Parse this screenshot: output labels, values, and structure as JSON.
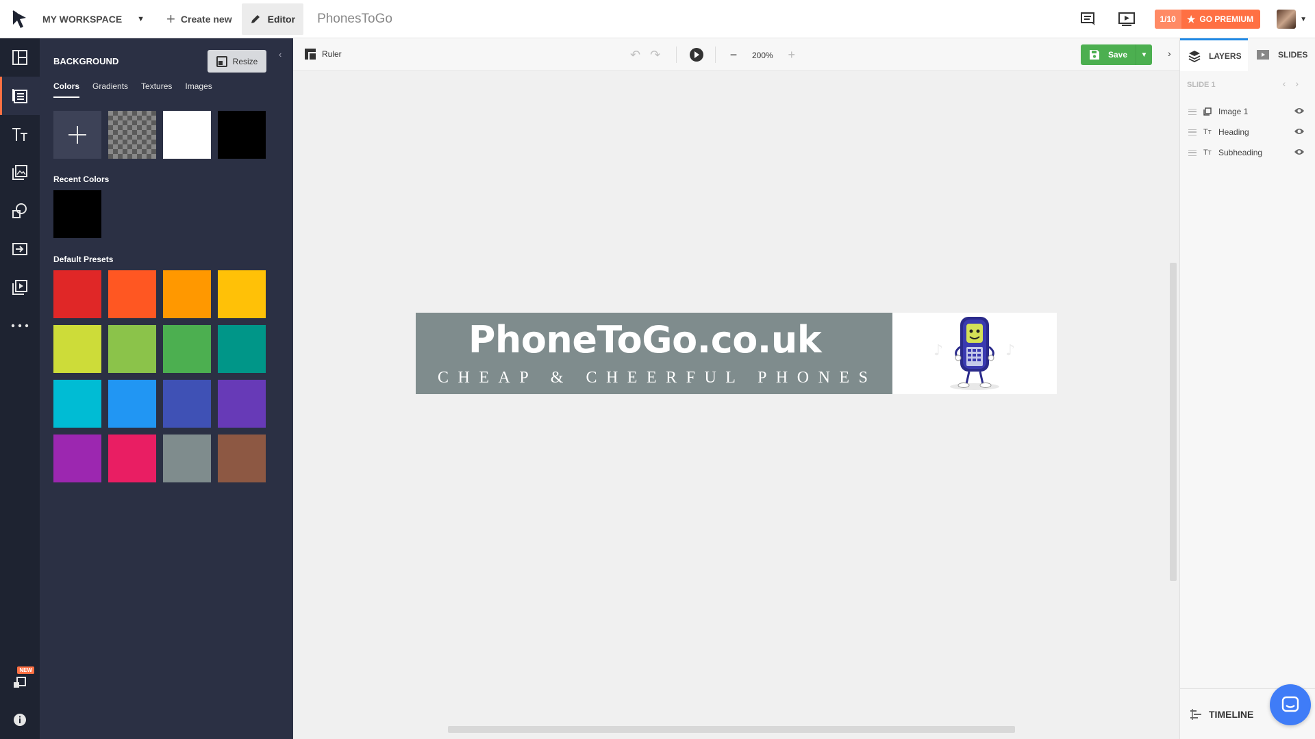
{
  "topbar": {
    "workspace_label": "MY WORKSPACE",
    "create_label": "Create new",
    "editor_label": "Editor",
    "document_title": "PhonesToGo",
    "premium_count": "1/10",
    "premium_label": "GO PREMIUM"
  },
  "rail": {
    "items": [
      "layout-icon",
      "background-icon",
      "text-icon",
      "images-icon",
      "shapes-icon",
      "import-icon",
      "animation-icon",
      "more-icon"
    ],
    "new_badge": "NEW"
  },
  "background_panel": {
    "title": "BACKGROUND",
    "resize_label": "Resize",
    "tabs": [
      "Colors",
      "Gradients",
      "Textures",
      "Images"
    ],
    "active_tab": "Colors",
    "recent_label": "Recent Colors",
    "defaults_label": "Default Presets",
    "top_swatches": [
      "add",
      "transparent",
      "#ffffff",
      "#000000"
    ],
    "recent_colors": [
      "#000000"
    ],
    "presets": [
      "#e02727",
      "#ff5722",
      "#ff9800",
      "#ffc107",
      "#cddc39",
      "#8bc34a",
      "#4caf50",
      "#009688",
      "#00bcd4",
      "#2196f3",
      "#3f51b5",
      "#673ab7",
      "#9c27b0",
      "#e91e63",
      "#7f8c8d",
      "#8d5843"
    ]
  },
  "canvas_toolbar": {
    "ruler_label": "Ruler",
    "zoom_value": "200%",
    "save_label": "Save"
  },
  "banner": {
    "heading": "PhoneToGo.co.uk",
    "subheading": "CHEAP & CHEERFUL PHONES",
    "bg_color": "#7f8c8d"
  },
  "right_panel": {
    "layers_tab": "LAYERS",
    "slides_tab": "SLIDES",
    "slide_label": "SLIDE 1",
    "layers": [
      {
        "name": "Image 1",
        "type": "image-icon"
      },
      {
        "name": "Heading",
        "type": "text-icon"
      },
      {
        "name": "Subheading",
        "type": "text-icon"
      }
    ],
    "timeline_label": "TIMELINE"
  },
  "colors": {
    "accent_orange": "#ff7043",
    "save_green": "#4caf50",
    "rail_bg": "#1e2331",
    "panel_bg": "#2b3044",
    "layers_blue": "#1e88e5"
  }
}
